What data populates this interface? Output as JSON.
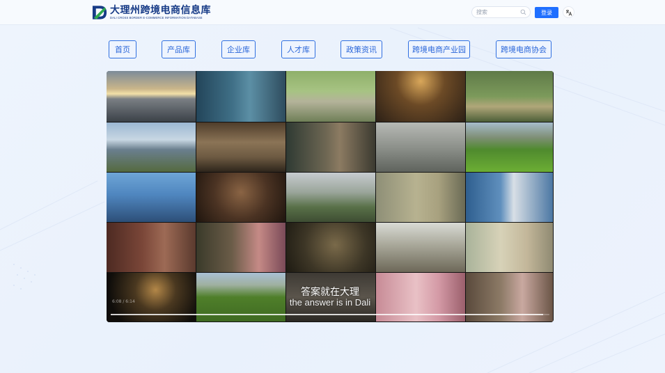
{
  "header": {
    "logo_cn": "大理州跨境电商信息库",
    "logo_en": "DALI CROSS BORDER E-COMMERCE INFORMATION DATABASE",
    "search_placeholder": "搜索",
    "login_label": "登录",
    "lang_icon": "translate-icon"
  },
  "nav": [
    {
      "label": "首页"
    },
    {
      "label": "产品库"
    },
    {
      "label": "企业库"
    },
    {
      "label": "人才库"
    },
    {
      "label": "政策资讯"
    },
    {
      "label": "跨境电商产业园"
    },
    {
      "label": "跨境电商协会"
    }
  ],
  "video": {
    "subtitle_cn": "答案就在大理",
    "subtitle_en": "the answer is in Dali",
    "time": "6:08 / 6:14",
    "progress": 0.985
  },
  "colors": {
    "accent": "#1f6fff",
    "nav_border": "#2f6fe0",
    "logo_blue": "#163a86",
    "logo_green": "#2fa84f"
  }
}
